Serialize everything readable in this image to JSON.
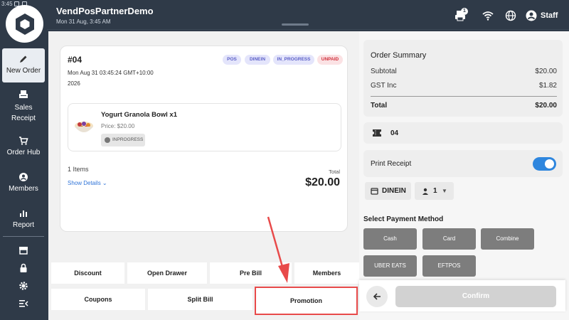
{
  "status_bar": {
    "time": "3:45"
  },
  "sidebar": {
    "items": [
      {
        "label": "New Order",
        "icon": "pencil-icon"
      },
      {
        "label": "Sales Receipt",
        "icon": "receipt-icon"
      },
      {
        "label": "Order Hub",
        "icon": "cart-icon"
      },
      {
        "label": "Members",
        "icon": "user-icon"
      },
      {
        "label": "Report",
        "icon": "bar-chart-icon"
      }
    ],
    "tools": [
      "store-icon",
      "lock-icon",
      "gear-icon",
      "menu-collapse-icon"
    ]
  },
  "header": {
    "app_title": "VendPosPartnerDemo",
    "date": "Mon 31 Aug, 3:45 AM",
    "printer_badge": "1",
    "user": "Staff"
  },
  "order": {
    "number": "#04",
    "datetime": "Mon Aug 31 03:45:24 GMT+10:00",
    "year": "2026",
    "chips": [
      "POS",
      "DINEIN",
      "IN_PROGRESS",
      "UNPAID"
    ],
    "item": {
      "name": "Yogurt Granola Bowl x1",
      "price": "Price: $20.00",
      "status": "INPROGRESS"
    },
    "items_count": "1 Items",
    "show_details": "Show Details",
    "total_label": "Total",
    "total_value": "$20.00"
  },
  "actions": {
    "row1": [
      "Discount",
      "Open Drawer",
      "Pre Bill",
      "Members"
    ],
    "row2": [
      "Coupons",
      "Split Bill",
      "Promotion"
    ]
  },
  "summary": {
    "title": "Order Summary",
    "subtotal_label": "Subtotal",
    "subtotal_value": "$20.00",
    "gst_label": "GST Inc",
    "gst_value": "$1.82",
    "total_label": "Total",
    "total_value": "$20.00"
  },
  "ticket": {
    "number": "04"
  },
  "print_receipt": {
    "label": "Print Receipt",
    "enabled": true
  },
  "dine": {
    "mode": "DINEIN",
    "guests": "1"
  },
  "payment": {
    "title": "Select Payment Method",
    "methods": [
      "Cash",
      "Card",
      "Combine",
      "UBER EATS",
      "EFTPOS"
    ]
  },
  "footer": {
    "confirm_label": "Confirm"
  },
  "colors": {
    "accent": "#2e86de",
    "highlight": "#e84a4a",
    "sidebar": "#2f3a48"
  }
}
